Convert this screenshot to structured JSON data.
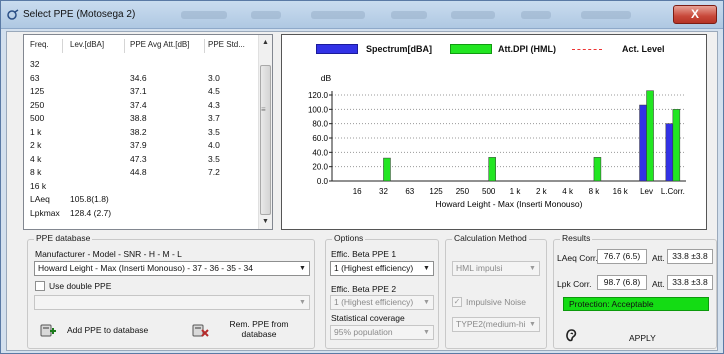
{
  "window": {
    "title": "Select PPE (Motosega 2)",
    "close_label": "X"
  },
  "table": {
    "headers": [
      "Freq.",
      "Lev.[dBA]",
      "PPE Avg Att.[dB]",
      "PPE Std..."
    ],
    "rows": [
      [
        "32",
        "",
        "",
        ""
      ],
      [
        "63",
        "",
        "34.6",
        "3.0"
      ],
      [
        "125",
        "",
        "37.1",
        "4.5"
      ],
      [
        "250",
        "",
        "37.4",
        "4.3"
      ],
      [
        "500",
        "",
        "38.8",
        "3.7"
      ],
      [
        "1 k",
        "",
        "38.2",
        "3.5"
      ],
      [
        "2 k",
        "",
        "37.9",
        "4.0"
      ],
      [
        "4 k",
        "",
        "47.3",
        "3.5"
      ],
      [
        "8 k",
        "",
        "44.8",
        "7.2"
      ],
      [
        "16 k",
        "",
        "",
        ""
      ],
      [
        "LAeq",
        "105.8(1.8)",
        "",
        ""
      ],
      [
        "Lpkmax",
        "128.4 (2.7)",
        "",
        ""
      ]
    ]
  },
  "chart_data": {
    "type": "bar",
    "legend": [
      {
        "name": "Spectrum[dBA]",
        "color": "#3232e6"
      },
      {
        "name": "Att.DPI (HML)",
        "color": "#22e622"
      },
      {
        "name": "Act. Level",
        "color": "#ee3333",
        "style": "dashed"
      }
    ],
    "ylabel": "dB",
    "ylim": [
      0,
      120
    ],
    "yticks": [
      "0.0",
      "20.0",
      "40.0",
      "60.0",
      "80.0",
      "100.0",
      "120.0"
    ],
    "categories": [
      "16",
      "32",
      "63",
      "125",
      "250",
      "500",
      "1 k",
      "2 k",
      "4 k",
      "8 k",
      "16 k",
      "Lev",
      "L.Corr."
    ],
    "series": [
      {
        "name": "Spectrum[dBA]",
        "color": "#3232e6",
        "values": [
          0,
          0,
          0,
          0,
          0,
          0,
          0,
          0,
          0,
          0,
          0,
          106,
          80
        ]
      },
      {
        "name": "Att.DPI (HML)",
        "color": "#22e622",
        "values": [
          0,
          32,
          0,
          0,
          0,
          33,
          0,
          0,
          0,
          33,
          0,
          126,
          100
        ]
      }
    ],
    "xlabel": "Howard Leight - Max (Inserti Monouso)",
    "grid": true
  },
  "database": {
    "title": "PPE database",
    "subtitle": "Manufacturer  -  Model  -  SNR  -  H - M - L",
    "selected": "Howard Leight - Max (Inserti Monouso) - 37 - 36 - 35 - 34",
    "double_label": "Use double PPE",
    "second_value": "",
    "add_label": "Add PPE to database",
    "remove_label": "Rem. PPE from database"
  },
  "options": {
    "title": "Options",
    "beta1_label": "Effic. Beta PPE 1",
    "beta1_value": "1 (Highest efficiency)",
    "beta2_label": "Effic. Beta PPE 2",
    "beta2_value": "1 (Highest efficiency)",
    "coverage_label": "Statistical coverage",
    "coverage_value": "95% population"
  },
  "method": {
    "title": "Calculation Method",
    "value": "HML impulsi",
    "impulsive_label": "Impulsive Noise",
    "type_value": "TYPE2(medium-hi"
  },
  "results": {
    "title": "Results",
    "laeq_label": "LAeq Corr.",
    "laeq_value": "76.7 (6.5)",
    "laeq_att_label": "Att.",
    "laeq_att_value": "33.8 ±3.8",
    "lpk_label": "Lpk Corr.",
    "lpk_value": "98.7 (6.8)",
    "lpk_att_label": "Att.",
    "lpk_att_value": "33.8 ±3.8",
    "protection": "Protection: Acceptable",
    "apply_label": "APPLY"
  }
}
